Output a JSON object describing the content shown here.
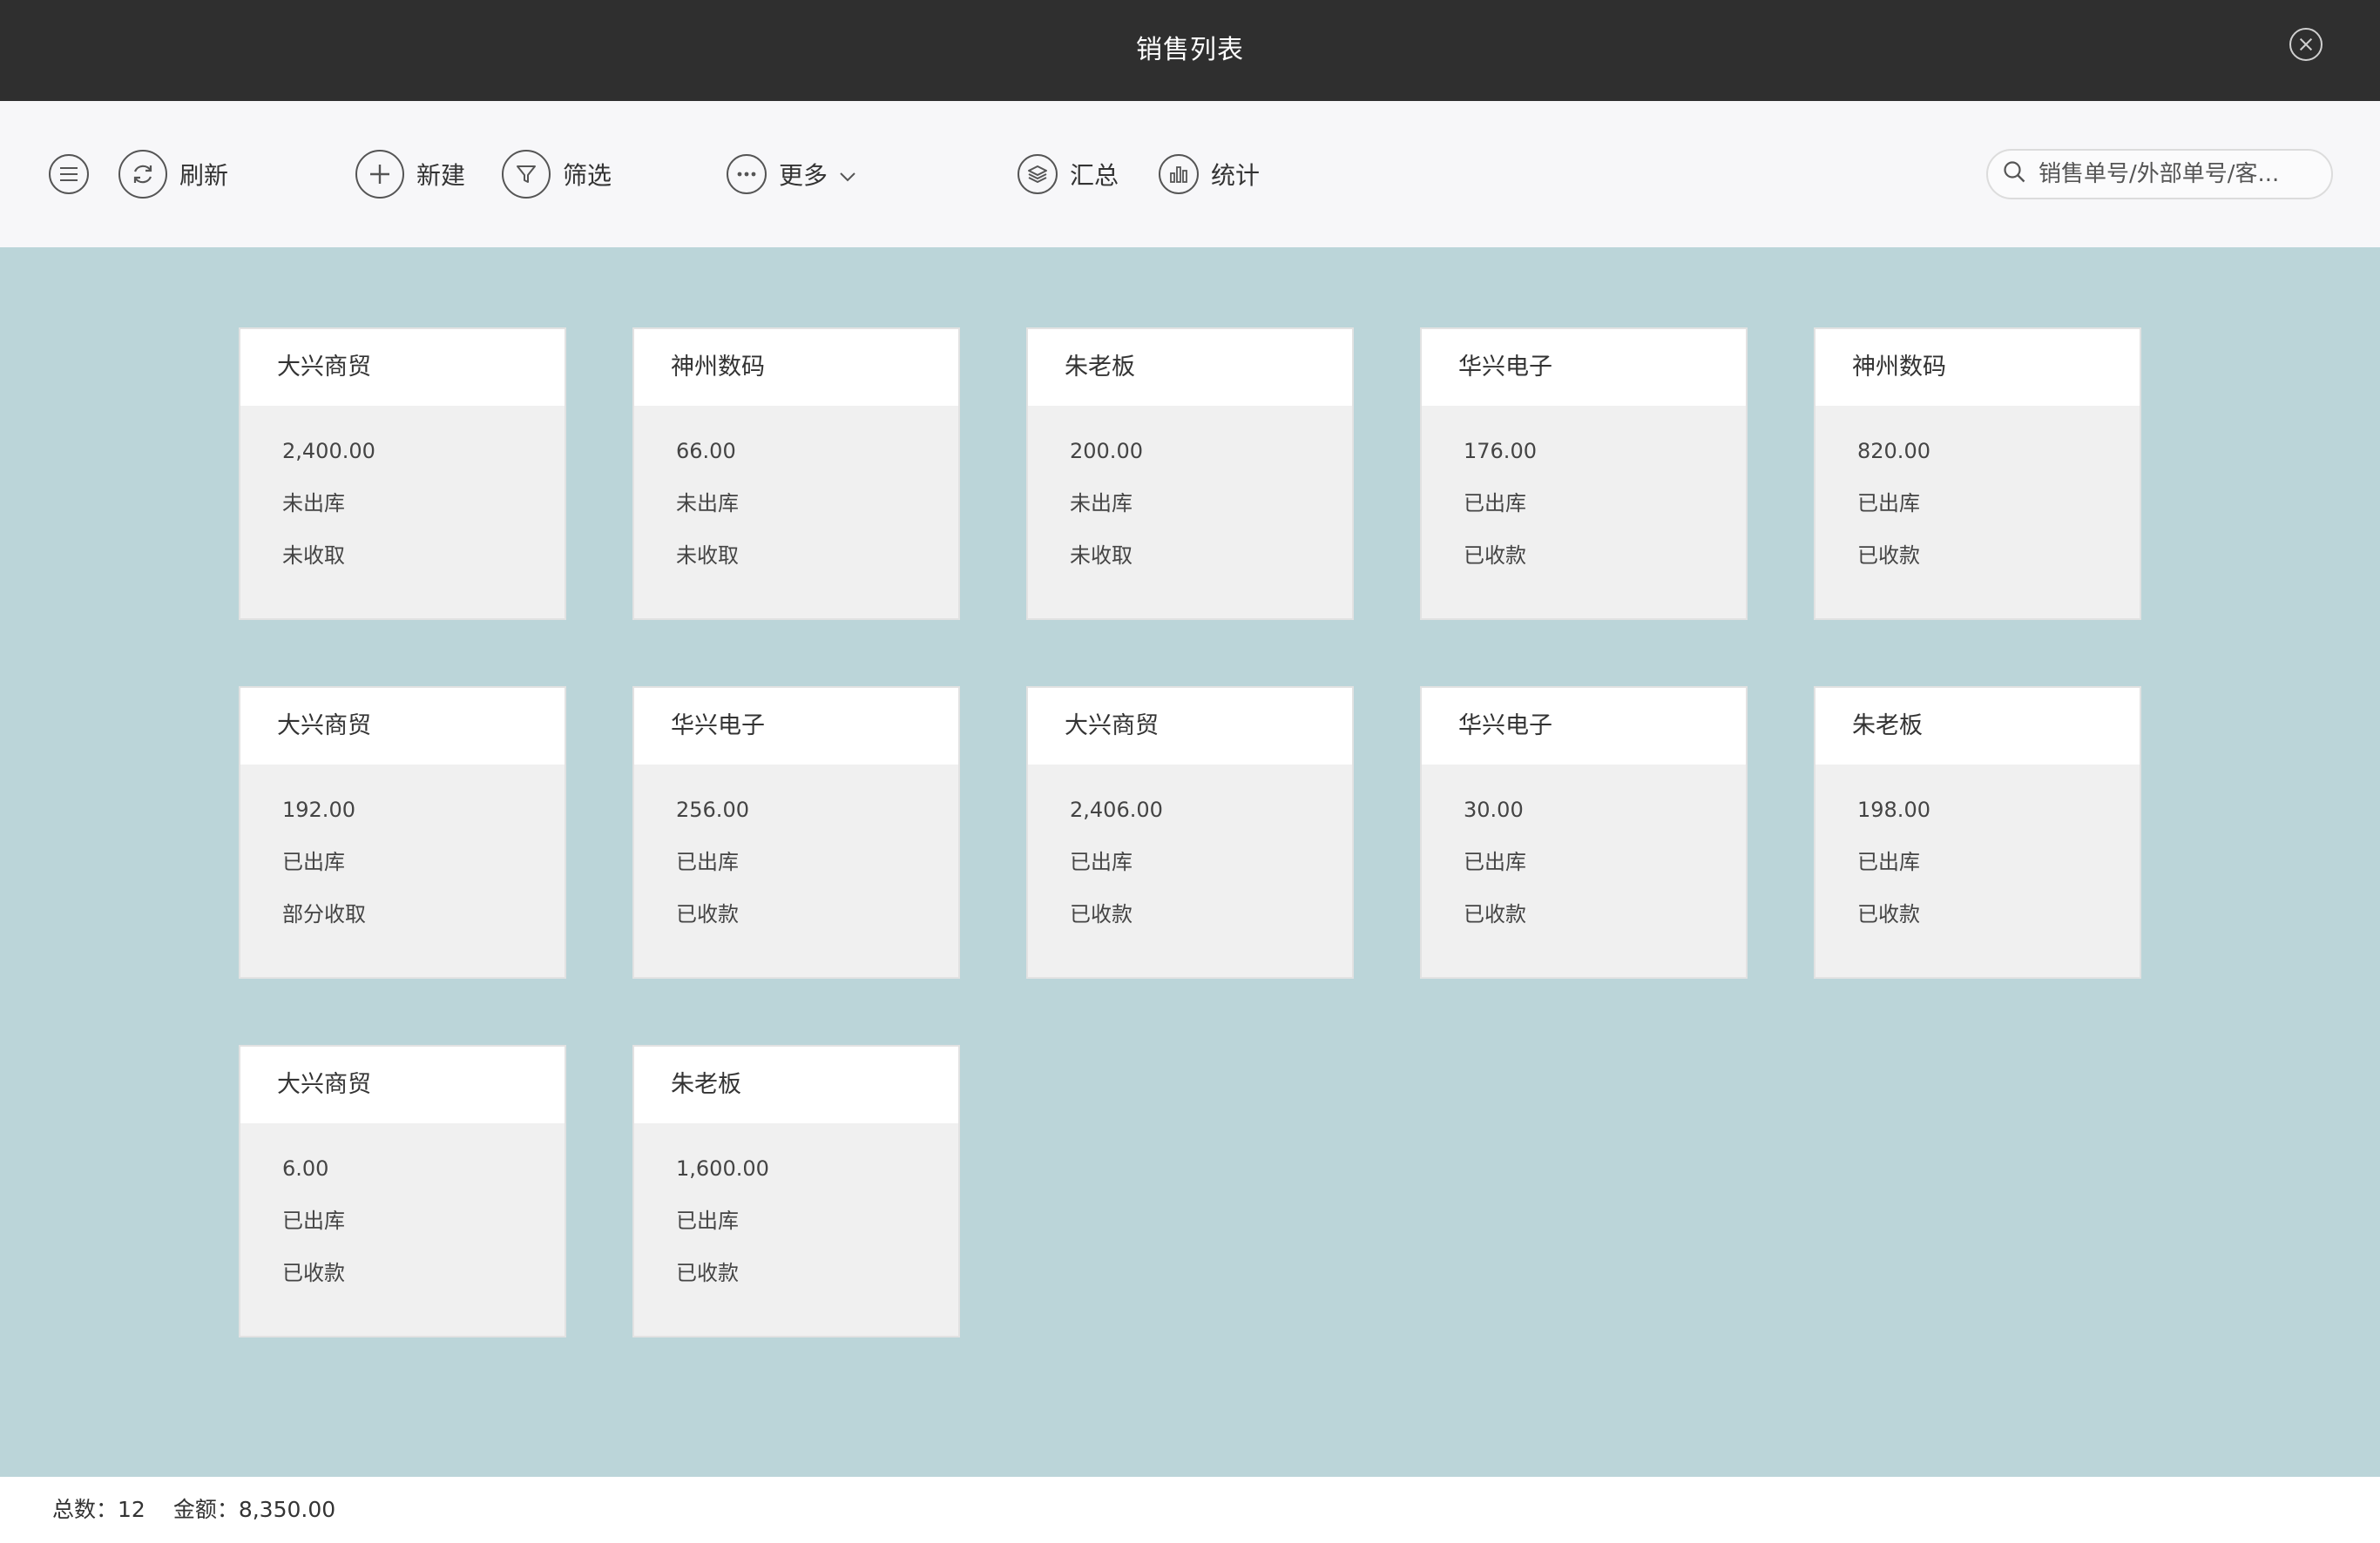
{
  "window": {
    "title": "销售列表"
  },
  "toolbar": {
    "refresh_label": "刷新",
    "new_label": "新建",
    "filter_label": "筛选",
    "more_label": "更多",
    "summary_label": "汇总",
    "stats_label": "统计",
    "search_placeholder": "销售单号/外部单号/客..."
  },
  "cards": [
    {
      "customer": "大兴商贸",
      "amount": "2,400.00",
      "shipping": "未出库",
      "payment": "未收取"
    },
    {
      "customer": "神州数码",
      "amount": "66.00",
      "shipping": "未出库",
      "payment": "未收取"
    },
    {
      "customer": "朱老板",
      "amount": "200.00",
      "shipping": "未出库",
      "payment": "未收取"
    },
    {
      "customer": "华兴电子",
      "amount": "176.00",
      "shipping": "已出库",
      "payment": "已收款"
    },
    {
      "customer": "神州数码",
      "amount": "820.00",
      "shipping": "已出库",
      "payment": "已收款"
    },
    {
      "customer": "大兴商贸",
      "amount": "192.00",
      "shipping": "已出库",
      "payment": "部分收取"
    },
    {
      "customer": "华兴电子",
      "amount": "256.00",
      "shipping": "已出库",
      "payment": "已收款"
    },
    {
      "customer": "大兴商贸",
      "amount": "2,406.00",
      "shipping": "已出库",
      "payment": "已收款"
    },
    {
      "customer": "华兴电子",
      "amount": "30.00",
      "shipping": "已出库",
      "payment": "已收款"
    },
    {
      "customer": "朱老板",
      "amount": "198.00",
      "shipping": "已出库",
      "payment": "已收款"
    },
    {
      "customer": "大兴商贸",
      "amount": "6.00",
      "shipping": "已出库",
      "payment": "已收款"
    },
    {
      "customer": "朱老板",
      "amount": "1,600.00",
      "shipping": "已出库",
      "payment": "已收款"
    }
  ],
  "footer": {
    "total_count": "总数：12",
    "total_amount": "金额：8,350.00"
  },
  "colors": {
    "titlebar": "#2f2f2f",
    "toolbar": "#f7f7f9",
    "content_bg": "#bbd5d9",
    "card_body": "#f0f0f0"
  },
  "icons": {
    "menu": "menu-icon",
    "refresh": "refresh-icon",
    "new": "plus-icon",
    "filter": "filter-icon",
    "more": "more-dots-icon",
    "summary": "layers-icon",
    "stats": "bar-chart-icon",
    "search": "search-icon",
    "close": "close-icon"
  }
}
